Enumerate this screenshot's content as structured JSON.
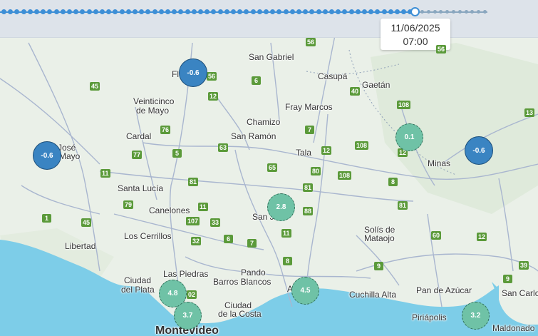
{
  "timeline": {
    "tooltip_date": "11/06/2025",
    "tooltip_time": "07:00"
  },
  "map": {
    "places": [
      {
        "name": "San Gabriel"
      },
      {
        "name": "Casupá"
      },
      {
        "name": "Gaetán"
      },
      {
        "name": "Veinticinco"
      },
      {
        "name": "de Mayo"
      },
      {
        "name": "Fray Marcos"
      },
      {
        "name": "Chamizo"
      },
      {
        "name": "Cardal"
      },
      {
        "name": "San Ramón"
      },
      {
        "name": "José"
      },
      {
        "name": "Mayo"
      },
      {
        "name": "Tala"
      },
      {
        "name": "Minas"
      },
      {
        "name": "Santa Lucía"
      },
      {
        "name": "Canelones"
      },
      {
        "name": "San J"
      },
      {
        "name": "Los Cerrillos"
      },
      {
        "name": "Solís de"
      },
      {
        "name": "Mataojo"
      },
      {
        "name": "Libertad"
      },
      {
        "name": "Pando"
      },
      {
        "name": "Las Piedras"
      },
      {
        "name": "Ciudad"
      },
      {
        "name": "del Plata"
      },
      {
        "name": "Barros Blancos"
      },
      {
        "name": "Ciudad"
      },
      {
        "name": "de la Costa"
      },
      {
        "name": "Cuchilla Alta"
      },
      {
        "name": "Pan de Azúcar"
      },
      {
        "name": "San Carlo"
      },
      {
        "name": "Piriápolis"
      },
      {
        "name": "Maldonado"
      },
      {
        "name": "Montevideo"
      },
      {
        "name": "Fl"
      },
      {
        "name": "A"
      }
    ],
    "routes": [
      "56",
      "56",
      "6",
      "40",
      "45",
      "56",
      "12",
      "108",
      "13",
      "76",
      "7",
      "12",
      "63",
      "108",
      "12",
      "77",
      "5",
      "65",
      "80",
      "11",
      "108",
      "81",
      "8",
      "81",
      "79",
      "11",
      "88",
      "81",
      "107",
      "33",
      "11",
      "1",
      "45",
      "6",
      "32",
      "7",
      "60",
      "12",
      "8",
      "9",
      "9",
      "39",
      "02"
    ],
    "markers": [
      {
        "value": "-0.6",
        "color": "blue"
      },
      {
        "value": "-0.6",
        "color": "blue"
      },
      {
        "value": "-0.6",
        "color": "blue"
      },
      {
        "value": "0.1",
        "color": "teal"
      },
      {
        "value": "2.8",
        "color": "teal"
      },
      {
        "value": "4.8",
        "color": "teal"
      },
      {
        "value": "3.7",
        "color": "teal"
      },
      {
        "value": "4.5",
        "color": "teal"
      },
      {
        "value": "3.2",
        "color": "teal"
      }
    ]
  }
}
